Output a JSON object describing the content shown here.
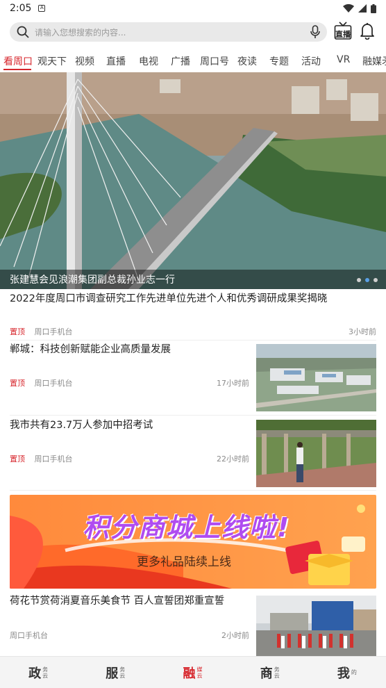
{
  "status_bar": {
    "time": "2:05"
  },
  "search": {
    "placeholder": "请输入您想搜索的内容..."
  },
  "header": {
    "live_label": "直播"
  },
  "tabs": [
    "看周口",
    "观天下",
    "视频",
    "直播",
    "电视",
    "广播",
    "周口号",
    "夜读",
    "专题",
    "活动",
    "VR",
    "融媒矛"
  ],
  "hero": {
    "caption": "张建慧会见浪潮集团副总裁孙业志一行",
    "slide_count": 3,
    "active_slide": 2
  },
  "news": [
    {
      "title": "2022年度周口市调查研究工作先进单位先进个人和优秀调研成果奖揭晓",
      "tag": "置顶",
      "source": "周口手机台",
      "time": "3小时前"
    },
    {
      "title": "郸城：科技创新赋能企业高质量发展",
      "tag": "置顶",
      "source": "周口手机台",
      "time": "17小时前"
    },
    {
      "title": "我市共有23.7万人参加中招考试",
      "tag": "置顶",
      "source": "周口手机台",
      "time": "22小时前"
    },
    {
      "title": "荷花节赏荷消夏音乐美食节  百人宣誓团郑重宣誓",
      "tag": "",
      "source": "周口手机台",
      "time": "2小时前"
    }
  ],
  "banner": {
    "headline": "积分商城上线啦!",
    "sub": "更多礼品陆续上线"
  },
  "bottom_nav": [
    {
      "char": "政",
      "sub": "务云"
    },
    {
      "char": "服",
      "sub": "务云"
    },
    {
      "char": "融",
      "sub": "媒云"
    },
    {
      "char": "商",
      "sub": "务云"
    },
    {
      "char": "我",
      "sub": "的"
    }
  ],
  "colors": {
    "accent": "#d7262c"
  }
}
